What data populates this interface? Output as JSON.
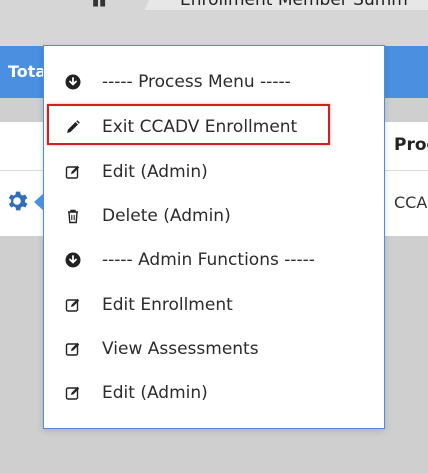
{
  "breadcrumb": {
    "text": "Enrollment Member Summ"
  },
  "header": {
    "label": "Tota"
  },
  "table": {
    "column_header": "Proc",
    "cell_value": "CCA"
  },
  "menu": {
    "items": [
      {
        "label": "----- Process Menu -----",
        "icon": "arrow-circle-down-icon"
      },
      {
        "label": "Exit CCADV Enrollment",
        "icon": "pencil-icon"
      },
      {
        "label": "Edit (Admin)",
        "icon": "edit-icon"
      },
      {
        "label": "Delete (Admin)",
        "icon": "trash-icon"
      },
      {
        "label": "----- Admin Functions -----",
        "icon": "arrow-circle-down-icon"
      },
      {
        "label": "Edit Enrollment",
        "icon": "edit-icon"
      },
      {
        "label": "View Assessments",
        "icon": "edit-icon"
      },
      {
        "label": "Edit (Admin)",
        "icon": "edit-icon"
      }
    ]
  },
  "colors": {
    "accent": "#4a8fe0",
    "highlight": "#d02020",
    "gear": "#2f6fb8"
  }
}
